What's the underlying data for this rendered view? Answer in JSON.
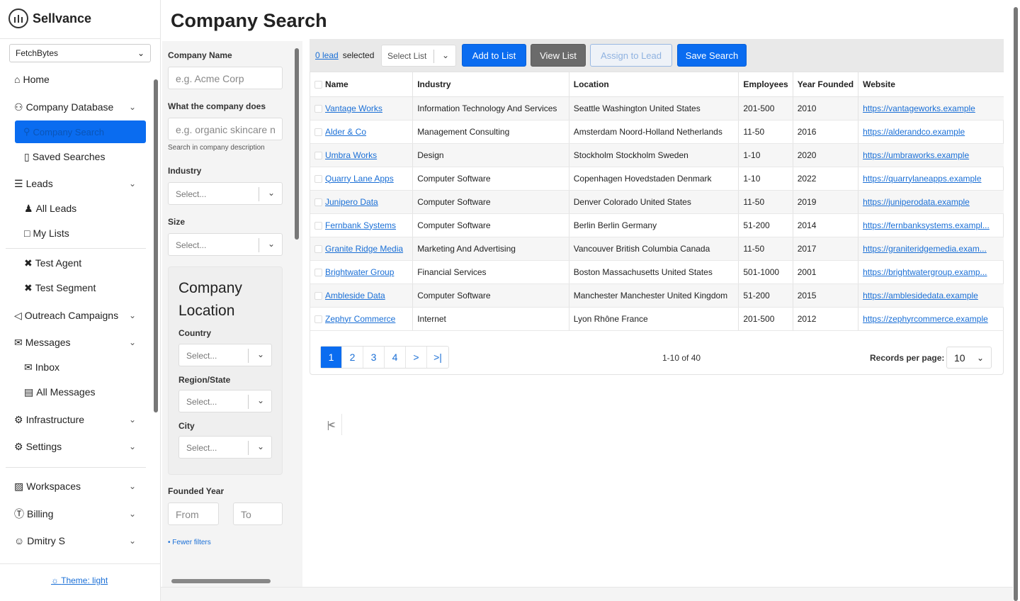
{
  "brand": {
    "name": "Sellvance"
  },
  "workspace_select": {
    "value": "FetchBytes"
  },
  "page_title": "Company Search",
  "nav": {
    "home": "Home",
    "company_database": "Company Database",
    "company_search": "Company Search",
    "saved_searches": "Saved Searches",
    "leads": "Leads",
    "all_leads": "All Leads",
    "my_lists": "My Lists",
    "test_agent": "Test Agent",
    "test_segment": "Test Segment",
    "outreach_campaigns": "Outreach Campaigns",
    "messages": "Messages",
    "inbox": "Inbox",
    "all_messages": "All Messages",
    "infrastructure": "Infrastructure",
    "settings": "Settings",
    "workspaces": "Workspaces",
    "billing": "Billing",
    "user": "Dmitry S",
    "theme": "Theme: light"
  },
  "filters": {
    "company_name_label": "Company Name",
    "company_name_placeholder": "e.g. Acme Corp",
    "does_label": "What the company does",
    "does_placeholder": "e.g. organic skincare n",
    "does_help": "Search in company description",
    "industry_label": "Industry",
    "industry_value": "Select...",
    "size_label": "Size",
    "size_value": "Select...",
    "location_title_1": "Company",
    "location_title_2": "Location",
    "country_label": "Country",
    "country_value": "Select...",
    "region_label": "Region/State",
    "region_value": "Select...",
    "city_label": "City",
    "city_value": "Select...",
    "founded_label": "Founded Year",
    "from_placeholder": "From",
    "to_placeholder": "To",
    "fewer_filters": "• Fewer filters"
  },
  "toolbar": {
    "lead_count": "0 lead",
    "selected": "selected",
    "select_list": "Select List",
    "add_to_list": "Add to List",
    "view_list": "View List",
    "assign_to_lead": "Assign to Lead",
    "save_search": "Save Search"
  },
  "table": {
    "headers": [
      "Name",
      "Industry",
      "Location",
      "Employees",
      "Year Founded",
      "Website"
    ],
    "rows": [
      [
        "Vantage Works",
        "Information Technology And Services",
        "Seattle Washington United States",
        "201-500",
        "2010",
        "https://vantageworks.example"
      ],
      [
        "Alder & Co",
        "Management Consulting",
        "Amsterdam Noord-Holland Netherlands",
        "11-50",
        "2016",
        "https://alderandco.example"
      ],
      [
        "Umbra Works",
        "Design",
        "Stockholm Stockholm Sweden",
        "1-10",
        "2020",
        "https://umbraworks.example"
      ],
      [
        "Quarry Lane Apps",
        "Computer Software",
        "Copenhagen Hovedstaden Denmark",
        "1-10",
        "2022",
        "https://quarrylaneapps.example"
      ],
      [
        "Junipero Data",
        "Computer Software",
        "Denver Colorado United States",
        "11-50",
        "2019",
        "https://juniperodata.example"
      ],
      [
        "Fernbank Systems",
        "Computer Software",
        "Berlin Berlin Germany",
        "51-200",
        "2014",
        "https://fernbanksystems.exampl..."
      ],
      [
        "Granite Ridge Media",
        "Marketing And Advertising",
        "Vancouver British Columbia Canada",
        "11-50",
        "2017",
        "https://graniteridgemedia.exam..."
      ],
      [
        "Brightwater Group",
        "Financial Services",
        "Boston Massachusetts United States",
        "501-1000",
        "2001",
        "https://brightwatergroup.examp..."
      ],
      [
        "Ambleside Data",
        "Computer Software",
        "Manchester Manchester United Kingdom",
        "51-200",
        "2015",
        "https://amblesidedata.example"
      ],
      [
        "Zephyr Commerce",
        "Internet",
        "Lyon Rhône France",
        "201-500",
        "2012",
        "https://zephyrcommerce.example"
      ]
    ]
  },
  "pagination": {
    "pages": [
      "1",
      "2",
      "3",
      "4"
    ],
    "first": "|<",
    "prev": "<",
    "next": ">",
    "last": ">|",
    "range": "1-10 of 40",
    "records_label": "Records per page:",
    "records_value": "10"
  }
}
